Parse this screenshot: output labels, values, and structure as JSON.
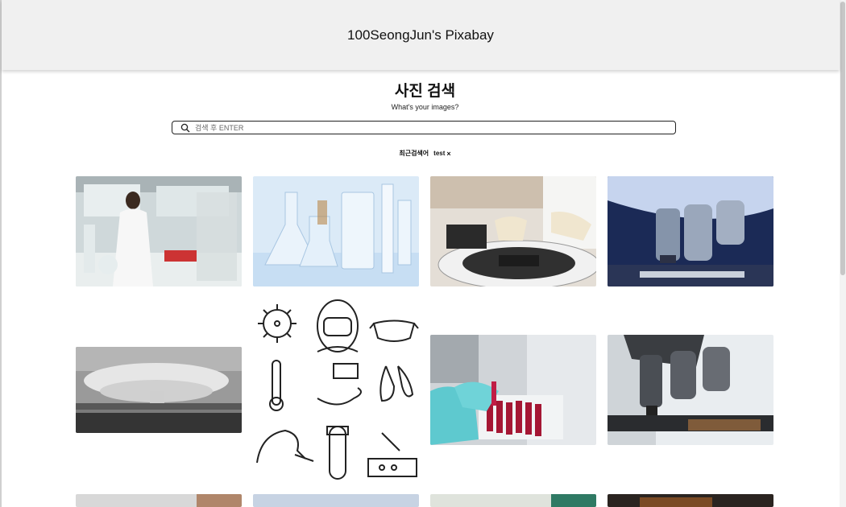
{
  "header": {
    "title": "100SeongJun's Pixabay"
  },
  "search": {
    "title": "사진 검색",
    "subtitle": "What's your images?",
    "placeholder": "검색 후 ENTER",
    "value": ""
  },
  "recent": {
    "label": "최근검색어",
    "items": [
      {
        "text": "test",
        "close": "×"
      }
    ]
  },
  "gallery": {
    "images": [
      {
        "name": "lab-researcher-photo",
        "icon": "laboratory"
      },
      {
        "name": "lab-glassware-photo",
        "icon": "glassware"
      },
      {
        "name": "centrifuge-gloves-photo",
        "icon": "centrifuge"
      },
      {
        "name": "microscope-blue-photo",
        "icon": "microscope"
      },
      {
        "name": "mushroom-cloud-photo",
        "icon": "explosion"
      },
      {
        "name": "covid-doodle-illustration",
        "icon": "doodles"
      },
      {
        "name": "blood-sample-tubes-photo",
        "icon": "test-tubes"
      },
      {
        "name": "microscope-grey-photo",
        "icon": "microscope"
      }
    ]
  }
}
